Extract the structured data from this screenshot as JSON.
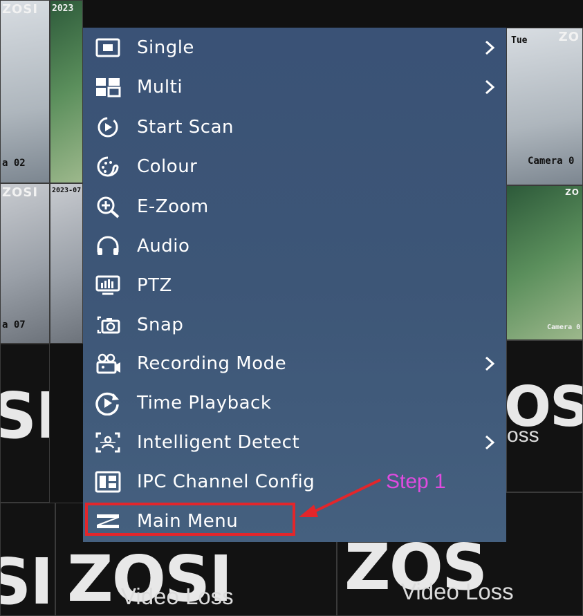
{
  "camera_tiles": {
    "brand": "ZOSI",
    "tl_date": "2023",
    "tl_label": "a 02",
    "tr_brand": "ZO",
    "tr_day": "Tue",
    "tr_label": "Camera 0",
    "ml_brand": "ZOSI",
    "ml_date": "2023-07",
    "ml_label": "a 07",
    "mr_brand": "ZO",
    "mr_label": "Camera 0"
  },
  "video_loss_tiles": {
    "logo_left_fragment": "SI",
    "logo_right_fragment": "OS",
    "logo_bottom_left": "ZOSI",
    "logo_bottom_right": "ZOS",
    "logo_far_left": "SI",
    "loss_text": "Video Loss",
    "loss_text_partial": "oss"
  },
  "menu": {
    "items": [
      {
        "label": "Single",
        "icon": "single-view-icon",
        "has_submenu": true
      },
      {
        "label": "Multi",
        "icon": "multi-view-icon",
        "has_submenu": true
      },
      {
        "label": "Start Scan",
        "icon": "scan-icon",
        "has_submenu": false
      },
      {
        "label": "Colour",
        "icon": "palette-icon",
        "has_submenu": false
      },
      {
        "label": "E-Zoom",
        "icon": "zoom-icon",
        "has_submenu": false
      },
      {
        "label": "Audio",
        "icon": "headphones-icon",
        "has_submenu": false
      },
      {
        "label": "PTZ",
        "icon": "ptz-icon",
        "has_submenu": false
      },
      {
        "label": "Snap",
        "icon": "snapshot-icon",
        "has_submenu": false
      },
      {
        "label": "Recording Mode",
        "icon": "recording-icon",
        "has_submenu": true
      },
      {
        "label": "Time Playback",
        "icon": "playback-icon",
        "has_submenu": false
      },
      {
        "label": "Intelligent Detect",
        "icon": "detect-icon",
        "has_submenu": true
      },
      {
        "label": "IPC Channel Config",
        "icon": "channel-config-icon",
        "has_submenu": false
      },
      {
        "label": "Main Menu",
        "icon": "zosi-logo-icon",
        "has_submenu": false
      }
    ],
    "submenu_arrow_icon": "chevron-right-icon"
  },
  "annotation": {
    "step_label": "Step 1",
    "box_color": "#e3262b",
    "label_color": "#e14be0"
  },
  "colors": {
    "menu_bg": "#3d5677",
    "menu_text": "#ffffff"
  }
}
